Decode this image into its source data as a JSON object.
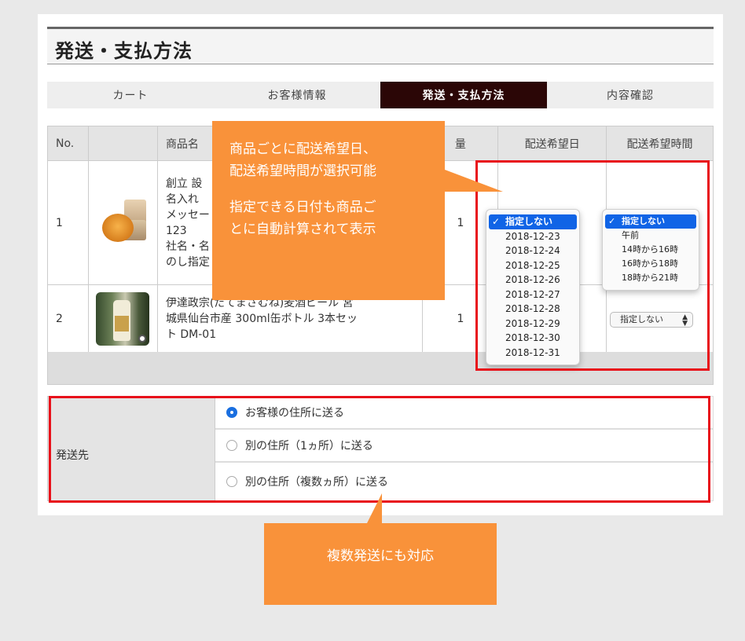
{
  "page_title": "発送・支払方法",
  "steps": [
    {
      "label": "カート",
      "active": false
    },
    {
      "label": "お客様情報",
      "active": false
    },
    {
      "label": "発送・支払方法",
      "active": true
    },
    {
      "label": "内容確認",
      "active": false
    }
  ],
  "table": {
    "headers": [
      "No.",
      "",
      "商品名",
      "量",
      "配送希望日",
      "配送希望時間"
    ],
    "rows": [
      {
        "no": "1",
        "name_lines": [
          "創立 設",
          "名入れ",
          "メッセー",
          "123",
          "社名・名",
          "のし指定"
        ],
        "qty": "1"
      },
      {
        "no": "2",
        "name_lines": [
          "伊達政宗(だてまさむね)麦酒ビール 宮",
          "城県仙台市産 300ml缶ボトル 3本セッ",
          "ト DM-01"
        ],
        "qty": "1"
      }
    ]
  },
  "date_dropdown": {
    "selected": "指定しない",
    "options": [
      "2018-12-23",
      "2018-12-24",
      "2018-12-25",
      "2018-12-26",
      "2018-12-27",
      "2018-12-28",
      "2018-12-29",
      "2018-12-30",
      "2018-12-31"
    ]
  },
  "time_dropdown": {
    "selected": "指定しない",
    "options": [
      "午前",
      "14時から16時",
      "16時から18時",
      "18時から21時"
    ]
  },
  "time_select_row2": {
    "value": "指定しない"
  },
  "callout_top": {
    "lines": [
      "商品ごとに配送希望日、",
      "配送希望時間が選択可能"
    ],
    "lines2": [
      "指定できる日付も商品ご",
      "とに自動計算されて表示"
    ]
  },
  "shipping": {
    "label": "発送先",
    "options": [
      {
        "label": "お客様の住所に送る",
        "checked": true
      },
      {
        "label": "別の住所（1ヵ所）に送る",
        "checked": false
      },
      {
        "label": "別の住所（複数ヵ所）に送る",
        "checked": false
      }
    ]
  },
  "callout_bottom": {
    "text": "複数発送にも対応"
  },
  "colors": {
    "accent_orange": "#f9923a",
    "highlight_red": "#e8101a",
    "active_step": "#2b0606",
    "select_blue": "#1064e6"
  }
}
